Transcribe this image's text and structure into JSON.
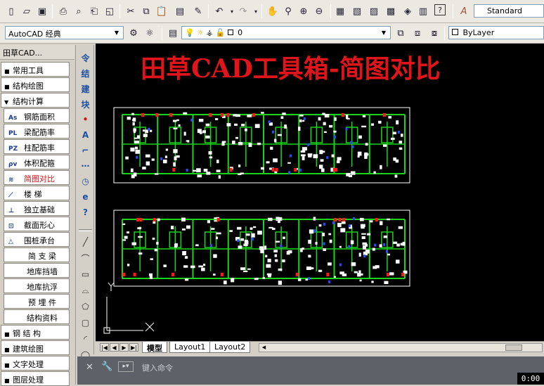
{
  "toolbar": {
    "text_style": "Standard",
    "workspace": "AutoCAD 经典",
    "layer": "0",
    "color": "ByLayer"
  },
  "panel": {
    "title": "田草CAD...",
    "sections": [
      {
        "label": "常用工具",
        "marker": "■"
      },
      {
        "label": "结构绘图",
        "marker": "■"
      },
      {
        "label": "结构计算",
        "marker": "▼"
      }
    ],
    "calc_items": [
      {
        "icon": "As",
        "label": "钢筋面积"
      },
      {
        "icon": "PL",
        "label": "梁配筋率"
      },
      {
        "icon": "PZ",
        "label": "柱配筋率"
      },
      {
        "icon": "ρv",
        "label": "体积配箍"
      },
      {
        "icon": "≋",
        "label": "简图对比"
      },
      {
        "icon": "⟋",
        "label": "楼  梯"
      },
      {
        "icon": "⊥",
        "label": "独立基础"
      },
      {
        "icon": "⊡",
        "label": "截面形心"
      },
      {
        "icon": "△",
        "label": "围桩承台"
      },
      {
        "icon": "",
        "label": "简 支 梁"
      },
      {
        "icon": "",
        "label": "地库挡墙"
      },
      {
        "icon": "",
        "label": "地库抗浮"
      },
      {
        "icon": "",
        "label": "预 埋 件"
      },
      {
        "icon": "",
        "label": "结构资料"
      }
    ],
    "tail_sections": [
      {
        "label": "钢 结 构",
        "marker": "■"
      },
      {
        "label": "建筑绘图",
        "marker": "■"
      },
      {
        "label": "文字处理",
        "marker": "■"
      },
      {
        "label": "图层处理",
        "marker": "■"
      }
    ]
  },
  "vtool": {
    "upper": [
      "令",
      "结",
      "建",
      "块",
      "•",
      "A",
      "⌐",
      "⋯",
      "◷",
      "e",
      "?"
    ],
    "lower": [
      "╱",
      "⌒",
      "▭",
      "⌓",
      "⬠",
      "▢",
      "◜",
      "◯"
    ]
  },
  "canvas": {
    "heading": "田草CAD工具箱-简图对比"
  },
  "layouts": {
    "tabs": [
      "模型",
      "Layout1",
      "Layout2"
    ]
  },
  "command": {
    "placeholder": "键入命令"
  },
  "timer": "0:00"
}
